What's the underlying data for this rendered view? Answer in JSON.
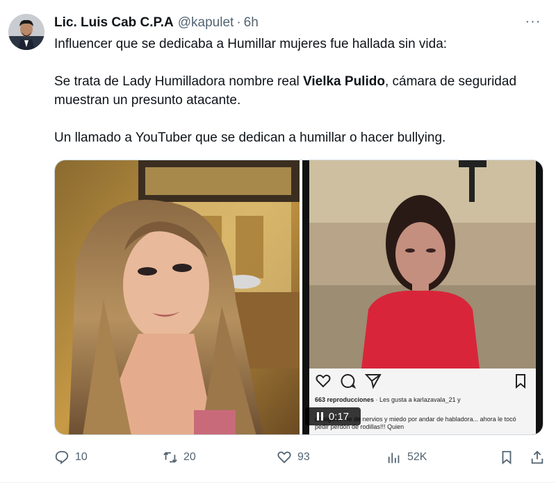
{
  "tweet": {
    "author_name": "Lic. Luis Cab C.P.A",
    "handle": "@kapulet",
    "separator": "·",
    "time": "6h",
    "more_label": "···",
    "line1": "Influencer que se dedicaba a Humillar mujeres fue hallada sin vida:",
    "line2_a": "Se trata de Lady Humilladora nombre real ",
    "line2_bold": "Vielka Pulido",
    "line2_b": ", cámara de seguridad muestran un presunto atacante.",
    "line3": "Un llamado a YouTuber que se dedican a humillar o hacer bullying."
  },
  "video": {
    "reproductions": "663 reproducciones",
    "likes_text": " · Les gusta a karlazavala_21 y",
    "caption": "cc alguien ríe de nervios y miedo por andar de habladora... ahora le tocó pedir perdón de rodillas!!! Quien",
    "time": "0:17"
  },
  "actions": {
    "replies": "10",
    "retweets": "20",
    "likes": "93",
    "views": "52K"
  },
  "colors": {
    "text": "#0f1419",
    "secondary": "#536471",
    "border": "#cfd9de"
  }
}
